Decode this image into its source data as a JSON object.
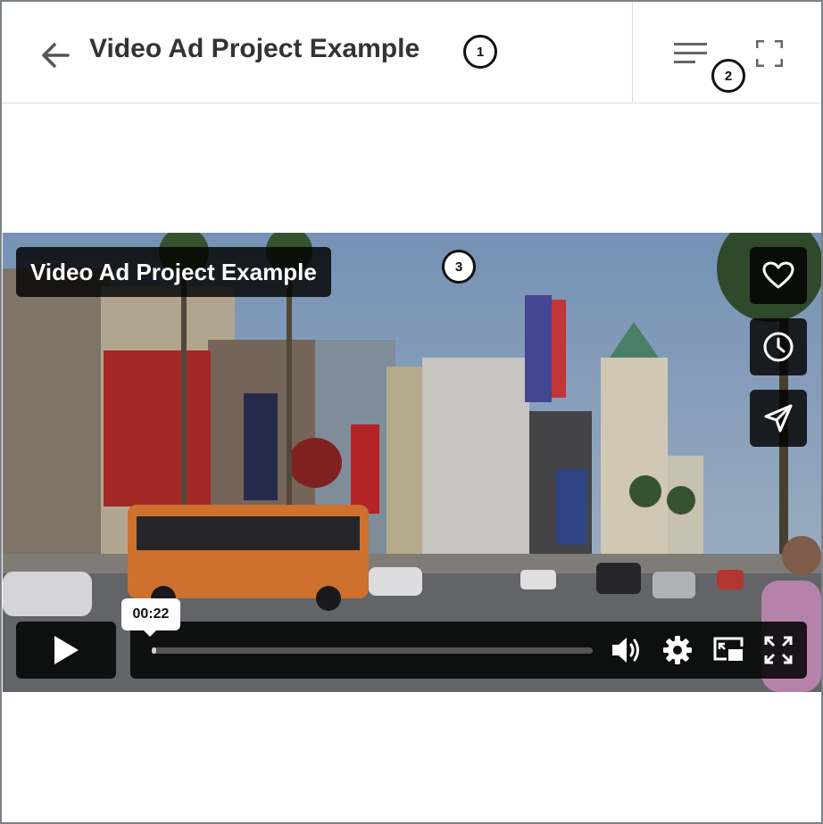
{
  "header": {
    "title": "Video Ad Project Example",
    "back_icon": "arrow-left-icon",
    "menu_icon": "menu-lines-icon",
    "fullscreen_icon": "fullscreen-corners-icon"
  },
  "callouts": [
    "1",
    "2",
    "3"
  ],
  "video": {
    "title": "Video Ad Project Example",
    "current_time": "00:22",
    "progress": 0.01,
    "side_actions": [
      "heart-icon",
      "clock-icon",
      "send-icon"
    ],
    "controls": [
      "play-icon",
      "volume-icon",
      "settings-gear-icon",
      "picture-in-picture-icon",
      "fullscreen-expand-icon"
    ]
  },
  "colors": {
    "text": "#333333",
    "overlay": "#000000",
    "frame_border": "#7b8288"
  }
}
